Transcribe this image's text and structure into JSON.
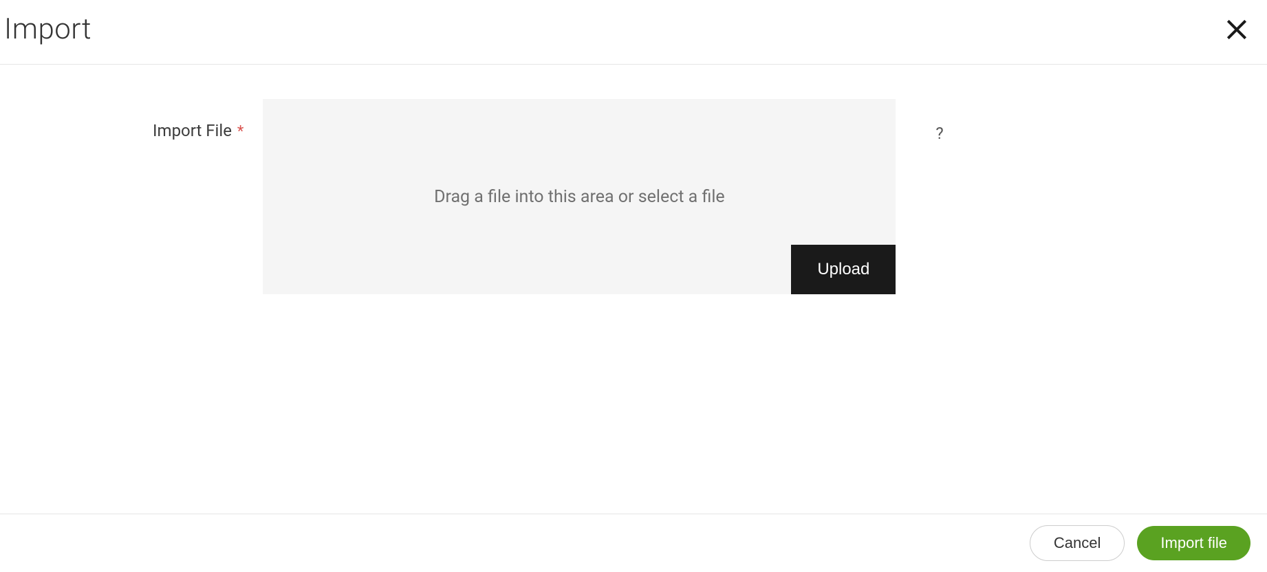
{
  "header": {
    "title": "Import"
  },
  "form": {
    "import_file_label": "Import File",
    "required_marker": "*",
    "dropzone_text": "Drag a file into this area or select a file",
    "upload_button_label": "Upload",
    "help_icon": "?"
  },
  "footer": {
    "cancel_label": "Cancel",
    "import_label": "Import file"
  }
}
